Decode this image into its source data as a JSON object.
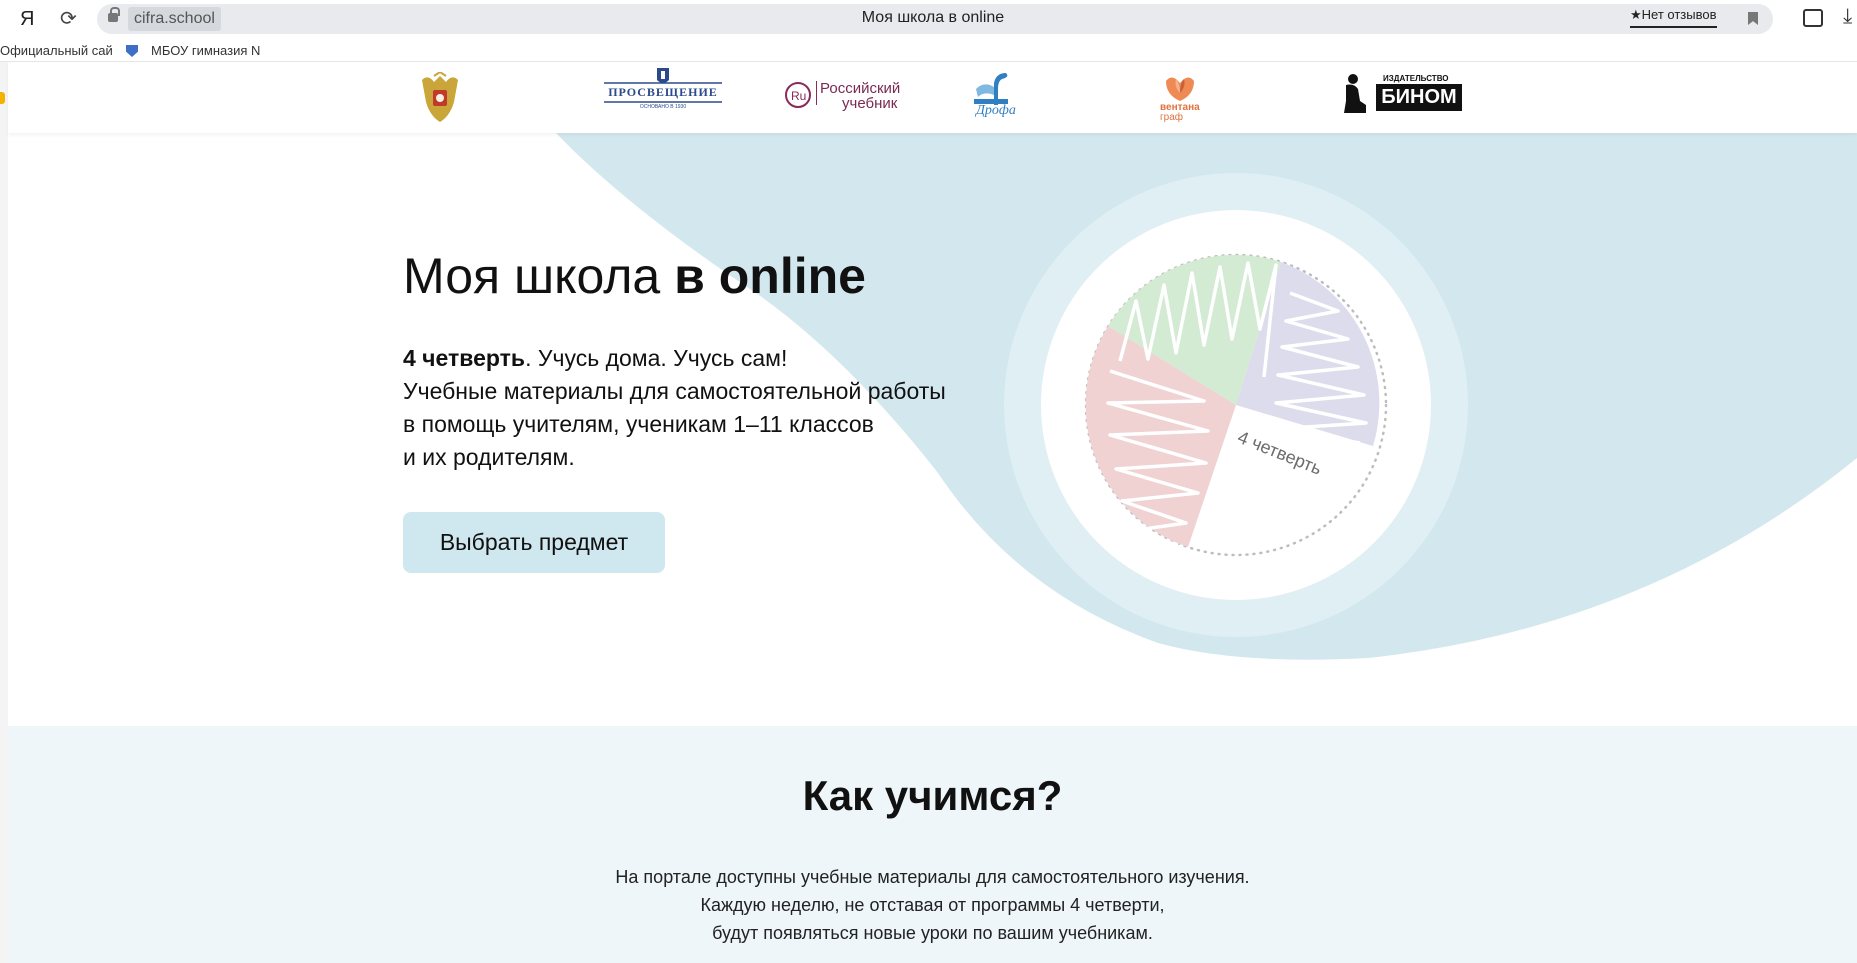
{
  "browser": {
    "logo": "Я",
    "reload_glyph": "⟳",
    "domain": "cifra.school",
    "tab_title": "Моя школа в online",
    "reviews_label": "★Нет отзывов",
    "download_glyph": "⤓"
  },
  "bookmarks": [
    {
      "label": "Официальный сай"
    },
    {
      "label": "МБОУ гимназия N"
    }
  ],
  "partners": {
    "prosv_name": "ПРОСВЕЩЕНИЕ",
    "prosv_sub": "ОСНОВАНО В 1930",
    "ru_line1": "Российский",
    "ru_line2": "учебник",
    "drofa": "Дрофа",
    "ventana_line1": "вентана",
    "ventana_line2": "граф",
    "binom_small": "ИЗДАТЕЛЬСТВО",
    "binom_name": "БИНОМ"
  },
  "hero": {
    "title_regular": "Моя школа ",
    "title_bold": "в online",
    "lead_bold": "4 четверть",
    "lead_rest": ". Учусь дома. Учусь сам!",
    "line2": "Учебные материалы для самостоятельной работы",
    "line3": "в помощь учителям, ученикам 1–11 классов",
    "line4": "и их родителям.",
    "cta": "Выбрать предмет",
    "pie_label": "4 четверть"
  },
  "how": {
    "title": "Как учимся?",
    "line1": "На портале доступны учебные материалы для самостоятельного изучения.",
    "line2": "Каждую неделю, не отставая от программы 4 четверти,",
    "line3": "будут появляться новые уроки по вашим учебникам."
  },
  "colors": {
    "wave": "#d3e8ee",
    "button": "#cfe7ee",
    "section_bg": "#eef6fa",
    "slice_green": "#d3ead3",
    "slice_purple": "#dcdcec",
    "slice_red": "#f0d2d2"
  }
}
